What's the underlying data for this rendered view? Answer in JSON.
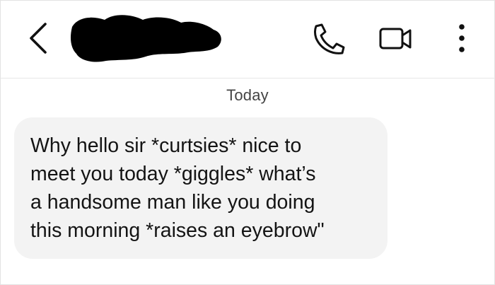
{
  "header": {
    "back_icon": "chevron-left-icon",
    "contact_name_redacted": true,
    "call_icon": "phone-icon",
    "video_icon": "video-camera-icon",
    "more_icon": "more-vertical-icon"
  },
  "conversation": {
    "date_divider": "Today",
    "messages": [
      {
        "direction": "incoming",
        "lines": [
          "Why hello sir *curtsies* nice to",
          "meet you today *giggles* what’s",
          "a handsome man like you doing",
          "this morning *raises an eyebrow\""
        ]
      }
    ]
  },
  "colors": {
    "bubble_background": "#f3f3f3",
    "icon_color": "#111111",
    "divider_text": "#444444",
    "redaction": "#000000"
  }
}
